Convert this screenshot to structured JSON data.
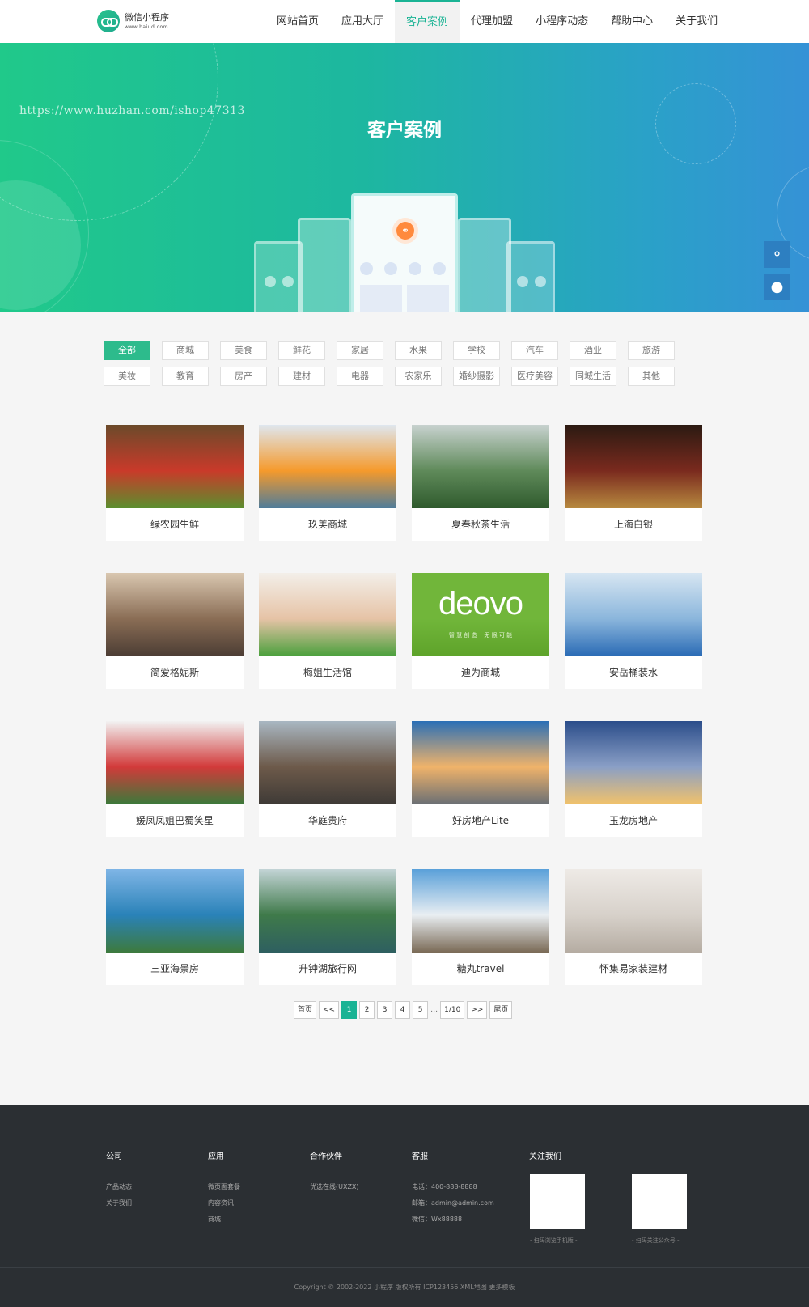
{
  "brand": {
    "title": "微信小程序",
    "sub": "www.baiud.com"
  },
  "nav": [
    "网站首页",
    "应用大厅",
    "客户案例",
    "代理加盟",
    "小程序动态",
    "帮助中心",
    "关于我们"
  ],
  "nav_active_index": 2,
  "banner": {
    "watermark": "https://www.huzhan.com/ishop47313",
    "title": "客户案例"
  },
  "side_buttons": [
    "wechat-icon",
    "qq-icon"
  ],
  "filters": {
    "row1": [
      "全部",
      "商城",
      "美食",
      "鲜花",
      "家居",
      "水果",
      "学校",
      "汽车",
      "酒业",
      "旅游"
    ],
    "row2": [
      "美妆",
      "教育",
      "房产",
      "建材",
      "电器",
      "农家乐",
      "婚纱摄影",
      "医疗美容",
      "同城生活",
      "其他"
    ],
    "active": "全部"
  },
  "cases": [
    {
      "title": "绿农园生鲜",
      "colors": [
        "#6b4a2a",
        "#c93a2a",
        "#5b8f2e"
      ]
    },
    {
      "title": "玖美商城",
      "colors": [
        "#dfe7ef",
        "#f59a2c",
        "#4f7c9a"
      ]
    },
    {
      "title": "夏春秋茶生活",
      "colors": [
        "#c8d2cf",
        "#5f8a5a",
        "#2f5a2d"
      ]
    },
    {
      "title": "上海白银",
      "colors": [
        "#2b1a12",
        "#7a2a1e",
        "#b7893f"
      ]
    },
    {
      "title": "简爱格妮斯",
      "colors": [
        "#d9c7b0",
        "#8a6d55",
        "#4c3d34"
      ]
    },
    {
      "title": "梅姐生活馆",
      "colors": [
        "#f3efe9",
        "#e6c3a6",
        "#4aa03c"
      ]
    },
    {
      "title": "迪为商城",
      "colors": [
        "#71b63a",
        "#71b63a",
        "#5ea32a"
      ],
      "logo": "deovo",
      "logo_sub": "智 慧 创 造    无 限 可 能"
    },
    {
      "title": "安岳桶装水",
      "colors": [
        "#d7e6f2",
        "#8bb6dc",
        "#2a6bb5"
      ]
    },
    {
      "title": "媛凤凤姐巴蜀笑星",
      "colors": [
        "#f2f2f2",
        "#d23a3a",
        "#3a7a3a"
      ]
    },
    {
      "title": "华庭贵府",
      "colors": [
        "#a9b7c2",
        "#6d5a4a",
        "#3e3a36"
      ]
    },
    {
      "title": "好房地产Lite",
      "colors": [
        "#2b6fb6",
        "#f0b36a",
        "#6a6f74"
      ]
    },
    {
      "title": "玉龙房地产",
      "colors": [
        "#2b4d8a",
        "#8a9fc6",
        "#f2c26a"
      ]
    },
    {
      "title": "三亚海景房",
      "colors": [
        "#7fb5e6",
        "#2a82b8",
        "#3d7a3d"
      ]
    },
    {
      "title": "升钟湖旅行网",
      "colors": [
        "#c3d4d6",
        "#3f7a4a",
        "#2e5f60"
      ]
    },
    {
      "title": "糖丸travel",
      "colors": [
        "#5aa0d9",
        "#e9eef2",
        "#7a6a56"
      ]
    },
    {
      "title": "怀集易家装建材",
      "colors": [
        "#eeeae6",
        "#d7d1ca",
        "#b5aca2"
      ]
    }
  ],
  "pagination": [
    "首页",
    "<<",
    "1",
    "2",
    "3",
    "4",
    "5",
    "…",
    "1/10",
    ">>",
    "尾页"
  ],
  "footer": {
    "cols": [
      {
        "title": "公司",
        "items": [
          "产品动态",
          "关于我们"
        ]
      },
      {
        "title": "应用",
        "items": [
          "微页面套餐",
          "内容资讯",
          "商城"
        ]
      },
      {
        "title": "合作伙伴",
        "items": [
          "优选在线(UXZX)"
        ]
      },
      {
        "title": "客服",
        "items": [
          "电话：400-888-8888",
          "邮箱：admin@admin.com",
          "微信：Wx88888"
        ]
      }
    ],
    "follow_title": "关注我们",
    "qr1_caption": "- 扫码浏览手机版 -",
    "qr2_caption": "- 扫码关注公众号 -",
    "copyright": "Copyright © 2002-2022 小程序 版权所有 ICP123456 XML地图 更多模板"
  }
}
